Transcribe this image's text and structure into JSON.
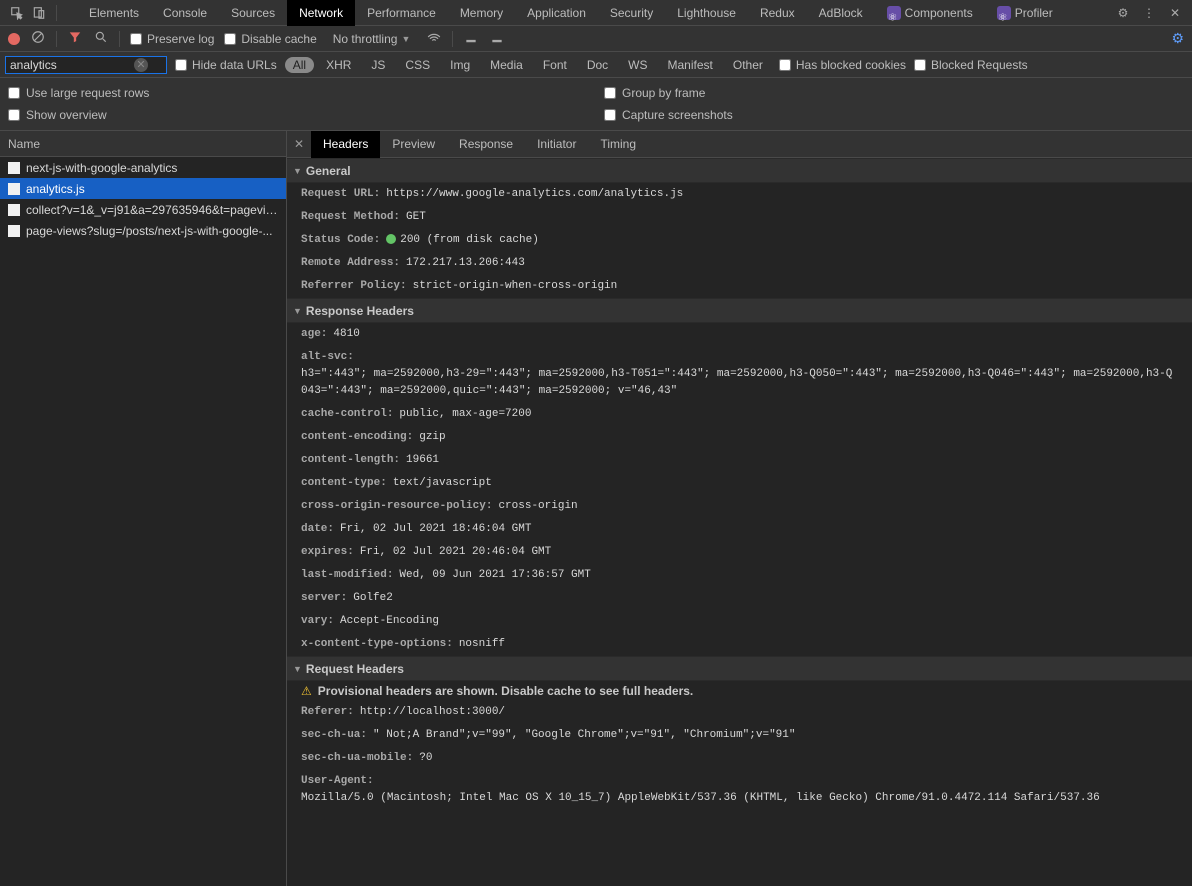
{
  "topTabs": {
    "items": [
      "Elements",
      "Console",
      "Sources",
      "Network",
      "Performance",
      "Memory",
      "Application",
      "Security",
      "Lighthouse",
      "Redux",
      "AdBlock"
    ],
    "extItems": [
      "Components",
      "Profiler"
    ],
    "activeIndex": 3
  },
  "toolbar2": {
    "preserveLog": "Preserve log",
    "disableCache": "Disable cache",
    "throttling": "No throttling"
  },
  "filter": {
    "value": "analytics",
    "hideDataUrls": "Hide data URLs",
    "types": [
      "All",
      "XHR",
      "JS",
      "CSS",
      "Img",
      "Media",
      "Font",
      "Doc",
      "WS",
      "Manifest",
      "Other"
    ],
    "activeType": 0,
    "hasBlockedCookies": "Has blocked cookies",
    "blockedRequests": "Blocked Requests"
  },
  "opts": {
    "largeRows": "Use large request rows",
    "groupByFrame": "Group by frame",
    "showOverview": "Show overview",
    "captureScreenshots": "Capture screenshots"
  },
  "sidebar": {
    "header": "Name",
    "rows": [
      "next-js-with-google-analytics",
      "analytics.js",
      "collect?v=1&_v=j91&a=297635946&t=pagevie...",
      "page-views?slug=/posts/next-js-with-google-..."
    ],
    "selectedIndex": 1
  },
  "detailTabs": {
    "items": [
      "Headers",
      "Preview",
      "Response",
      "Initiator",
      "Timing"
    ],
    "activeIndex": 0
  },
  "sections": {
    "general": {
      "title": "General",
      "rows": [
        {
          "k": "Request URL:",
          "v": "https://www.google-analytics.com/analytics.js"
        },
        {
          "k": "Request Method:",
          "v": "GET"
        },
        {
          "k": "Status Code:",
          "v": "200  (from disk cache)",
          "status": true
        },
        {
          "k": "Remote Address:",
          "v": "172.217.13.206:443"
        },
        {
          "k": "Referrer Policy:",
          "v": "strict-origin-when-cross-origin"
        }
      ]
    },
    "response": {
      "title": "Response Headers",
      "rows": [
        {
          "k": "age:",
          "v": "4810"
        },
        {
          "k": "alt-svc:",
          "v": "h3=\":443\"; ma=2592000,h3-29=\":443\"; ma=2592000,h3-T051=\":443\"; ma=2592000,h3-Q050=\":443\"; ma=2592000,h3-Q046=\":443\"; ma=2592000,h3-Q043=\":443\"; ma=2592000,quic=\":443\"; ma=2592000; v=\"46,43\""
        },
        {
          "k": "cache-control:",
          "v": "public, max-age=7200"
        },
        {
          "k": "content-encoding:",
          "v": "gzip"
        },
        {
          "k": "content-length:",
          "v": "19661"
        },
        {
          "k": "content-type:",
          "v": "text/javascript"
        },
        {
          "k": "cross-origin-resource-policy:",
          "v": "cross-origin"
        },
        {
          "k": "date:",
          "v": "Fri, 02 Jul 2021 18:46:04 GMT"
        },
        {
          "k": "expires:",
          "v": "Fri, 02 Jul 2021 20:46:04 GMT"
        },
        {
          "k": "last-modified:",
          "v": "Wed, 09 Jun 2021 17:36:57 GMT"
        },
        {
          "k": "server:",
          "v": "Golfe2"
        },
        {
          "k": "vary:",
          "v": "Accept-Encoding"
        },
        {
          "k": "x-content-type-options:",
          "v": "nosniff"
        }
      ]
    },
    "request": {
      "title": "Request Headers",
      "warning": "Provisional headers are shown. Disable cache to see full headers.",
      "rows": [
        {
          "k": "Referer:",
          "v": "http://localhost:3000/"
        },
        {
          "k": "sec-ch-ua:",
          "v": "\" Not;A Brand\";v=\"99\", \"Google Chrome\";v=\"91\", \"Chromium\";v=\"91\""
        },
        {
          "k": "sec-ch-ua-mobile:",
          "v": "?0"
        },
        {
          "k": "User-Agent:",
          "v": "Mozilla/5.0 (Macintosh; Intel Mac OS X 10_15_7) AppleWebKit/537.36 (KHTML, like Gecko) Chrome/91.0.4472.114 Safari/537.36"
        }
      ]
    }
  }
}
